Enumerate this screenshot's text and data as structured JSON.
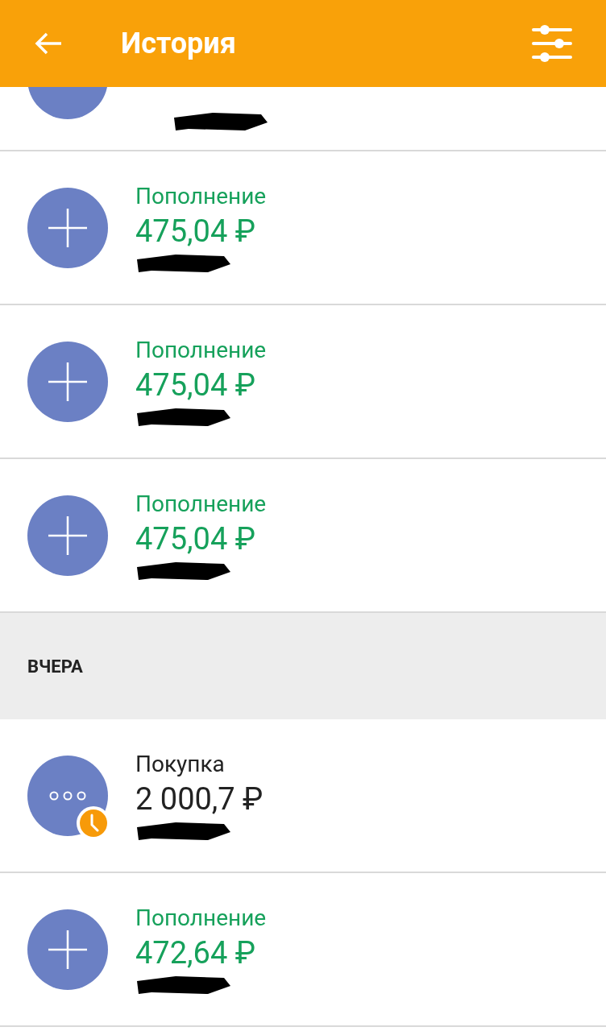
{
  "header": {
    "title": "История"
  },
  "groups": [
    {
      "items": [
        {
          "kind": "deposit",
          "partial": true
        },
        {
          "kind": "deposit",
          "label": "Пополнение",
          "amount": "475,04 ₽"
        },
        {
          "kind": "deposit",
          "label": "Пополнение",
          "amount": "475,04 ₽"
        },
        {
          "kind": "deposit",
          "label": "Пополнение",
          "amount": "475,04 ₽"
        }
      ]
    },
    {
      "title": "ВЧЕРА",
      "items": [
        {
          "kind": "purchase",
          "label": "Покупка",
          "amount": "2 000,7 ₽",
          "pending": true
        },
        {
          "kind": "deposit",
          "label": "Пополнение",
          "amount": "472,64 ₽"
        }
      ]
    }
  ]
}
